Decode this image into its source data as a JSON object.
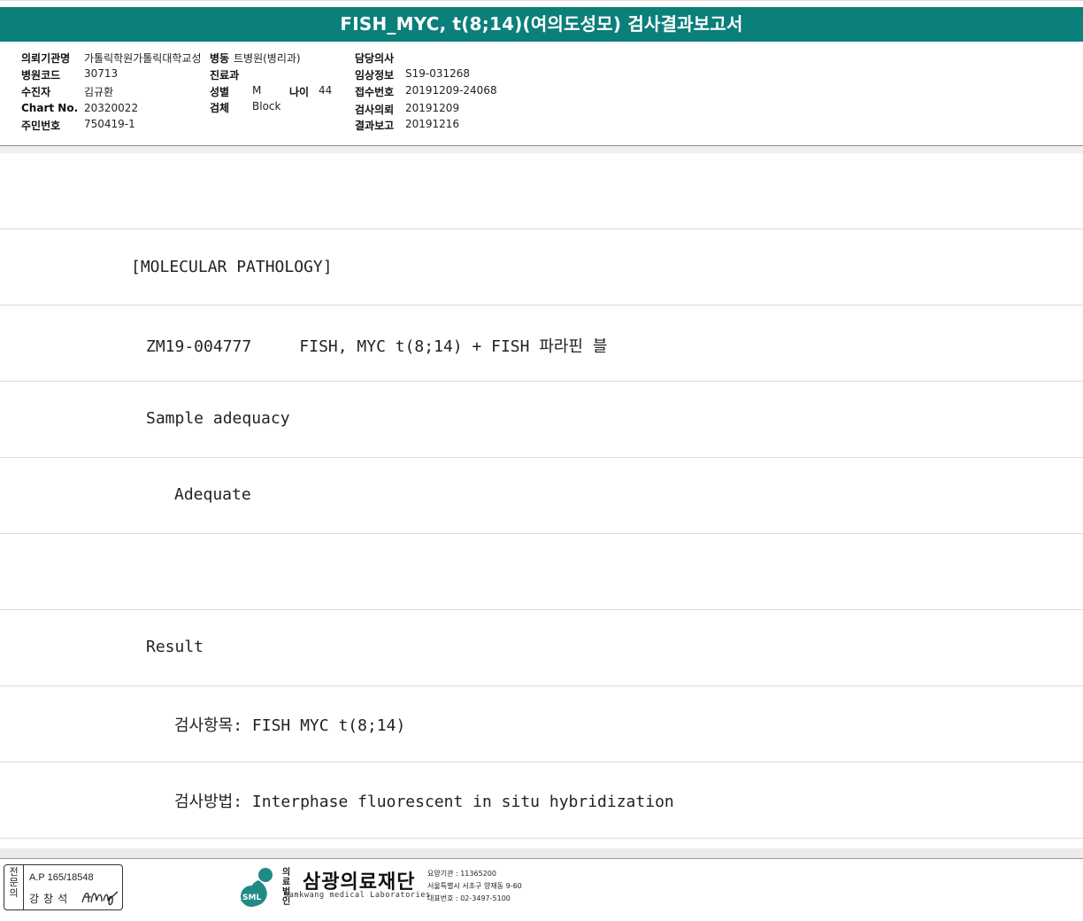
{
  "title": "FISH_MYC, t(8;14)(여의도성모) 검사결과보고서",
  "header": {
    "institution_label": "의뢰기관명",
    "institution_value": "가톨릭학원가톨릭대학교성",
    "ward_label": "병동",
    "ward_value": "트병원(병리과)",
    "doctor_label": "담당의사",
    "doctor_value": "",
    "hospital_code_label": "병원코드",
    "hospital_code_value": "30713",
    "dept_label": "진료과",
    "dept_value": "",
    "clinical_info_label": "임상정보",
    "clinical_info_value": "S19-031268",
    "patient_label": "수진자",
    "patient_value": "김규환",
    "sex_label": "성별",
    "sex_value": "M",
    "age_label": "나이",
    "age_value": "44",
    "receipt_label": "접수번호",
    "receipt_value": "20191209-24068",
    "chart_label": "Chart No.",
    "chart_value": "20320022",
    "specimen_label": "검체",
    "specimen_value": "Block",
    "request_label": "검사의뢰",
    "request_value": "20191209",
    "id_label": "주민번호",
    "id_value": "750419-1",
    "report_label": "결과보고",
    "report_value": "20191216"
  },
  "body_lines": [
    "",
    "[MOLECULAR PATHOLOGY]",
    "ZM19-004777     FISH, MYC t(8;14) + FISH 파라핀 블",
    "Sample adequacy",
    "Adequate",
    "",
    "Result",
    "검사항목: FISH MYC t(8;14)",
    "검사방법: Interphase fluorescent in situ hybridization"
  ],
  "footer": {
    "stamp_side": "전문의",
    "stamp_ap": "A.P 165/18548",
    "stamp_name": "강창석",
    "logo_hanja": "의료\n법인",
    "logo_name": "삼광의료재단",
    "logo_en": "Samkwang medical Laboratories",
    "logo_mark_text": "SML",
    "info1": "요양기관 : 11365200",
    "info2": "서울특별시 서초구 양재동 9-60",
    "info3": "대표번호 : 02-3497-5100",
    "brand_color": "#0b7f7a",
    "logo_color": "#1f8a86"
  }
}
